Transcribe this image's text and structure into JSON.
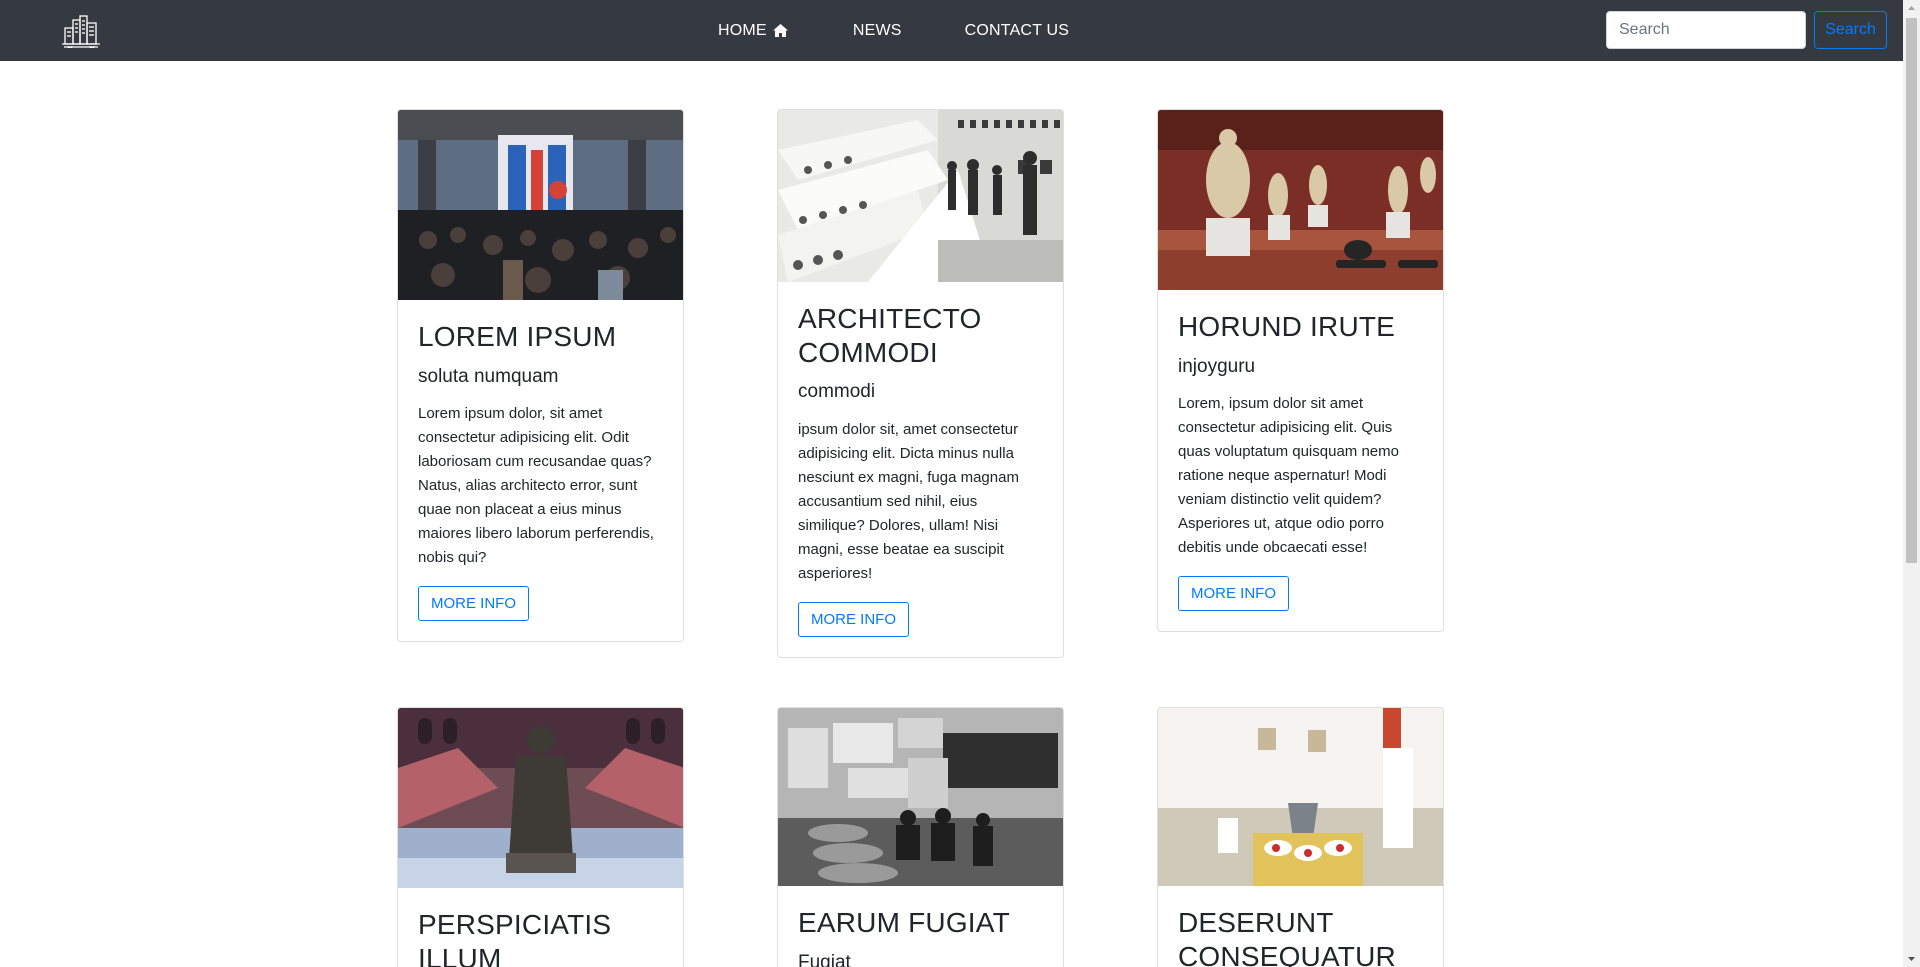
{
  "nav": {
    "home_label": "HOME",
    "news_label": "NEWS",
    "contact_label": "CONTACT US",
    "search_placeholder": "Search",
    "search_button": "Search"
  },
  "cards": [
    {
      "title": "LOREM IPSUM",
      "subtitle": "soluta numquam",
      "text": "Lorem ipsum dolor, sit amet consectetur adipisicing elit. Odit laboriosam cum recusandae quas? Natus, alias architecto error, sunt quae non placeat a eius minus maiores libero laborum perferendis, nobis qui?",
      "button": "MORE INFO"
    },
    {
      "title": "ARCHITECTO COMMODI",
      "subtitle": "commodi",
      "text": "ipsum dolor sit, amet consectetur adipisicing elit. Dicta minus nulla nesciunt ex magni, fuga magnam accusantium sed nihil, eius similique? Dolores, ullam! Nisi magni, esse beatae ea suscipit asperiores!",
      "button": "MORE INFO"
    },
    {
      "title": "HORUND IRUTE",
      "subtitle": "injoyguru",
      "text": "Lorem, ipsum dolor sit amet consectetur adipisicing elit. Quis quas voluptatum quisquam nemo ratione neque aspernatur! Modi veniam distinctio velit quidem? Asperiores ut, atque odio porro debitis unde obcaecati esse!",
      "button": "MORE INFO"
    },
    {
      "title": "PERSPICIATIS ILLUM",
      "subtitle": "",
      "text": "",
      "button": ""
    },
    {
      "title": "EARUM FUGIAT",
      "subtitle": "Fugiat",
      "text": "",
      "button": ""
    },
    {
      "title": "DESERUNT CONSEQUATUR",
      "subtitle": "",
      "text": "",
      "button": ""
    }
  ],
  "colors": {
    "navbar": "#343a40",
    "accent": "#007bff"
  },
  "icons": {
    "logo": "city-buildings-icon",
    "home": "home-icon"
  }
}
